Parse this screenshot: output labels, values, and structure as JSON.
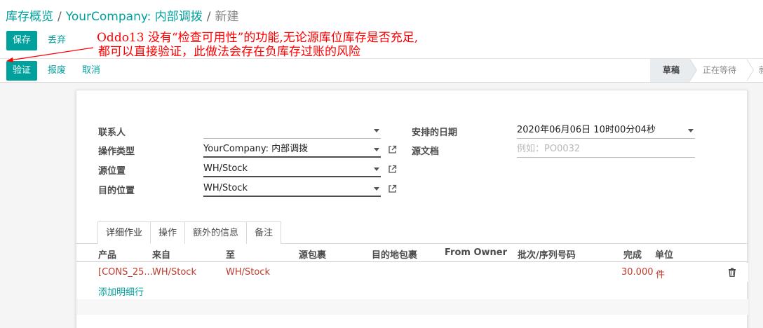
{
  "breadcrumb": {
    "root": "库存概览",
    "separator": "/",
    "parent": "YourCompany: 内部调拨",
    "current": "新建"
  },
  "toolbar": {
    "save_label": "保存",
    "discard_label": "丢弃"
  },
  "actions": {
    "validate_label": "验证",
    "scrap_label": "报废",
    "cancel_label": "取消"
  },
  "annotation": {
    "line1": "Oddo13 没有“检查可用性”的功能,无论源库位库存是否充足,",
    "line2": "都可以直接验证，此做法会存在负库存过账的风险",
    "color": "#ff0000"
  },
  "status": {
    "stages": [
      "草稿",
      "正在等待",
      "就"
    ],
    "active_index": 0
  },
  "form": {
    "contact": {
      "label": "联系人",
      "value": ""
    },
    "operation_type": {
      "label": "操作类型",
      "value": "YourCompany: 内部调拨"
    },
    "source_location": {
      "label": "源位置",
      "value": "WH/Stock"
    },
    "dest_location": {
      "label": "目的位置",
      "value": "WH/Stock"
    },
    "scheduled_date": {
      "label": "安排的日期",
      "value": "2020年06月06日 10时00分04秒"
    },
    "source_document": {
      "label": "源文档",
      "placeholder": "例如：PO0032"
    }
  },
  "tabs": [
    {
      "label": "详细作业",
      "active": true
    },
    {
      "label": "操作",
      "active": false
    },
    {
      "label": "额外的信息",
      "active": false
    },
    {
      "label": "备注",
      "active": false
    }
  ],
  "table": {
    "columns": [
      "产品",
      "来自",
      "至",
      "源包裹",
      "目的地包裹",
      "From Owner",
      "批次/序列号码",
      "完成",
      "单位"
    ],
    "rows": [
      {
        "product": "[CONS_25...",
        "from": "WH/Stock",
        "to": "WH/Stock",
        "source_package": "",
        "dest_package": "",
        "owner": "",
        "lot": "",
        "done": "30.000",
        "uom": "件"
      }
    ],
    "add_line_label": "添加明细行"
  },
  "colors": {
    "primary": "#00a09d",
    "row_text": "#c0392b",
    "annotation": "#ff0000"
  }
}
